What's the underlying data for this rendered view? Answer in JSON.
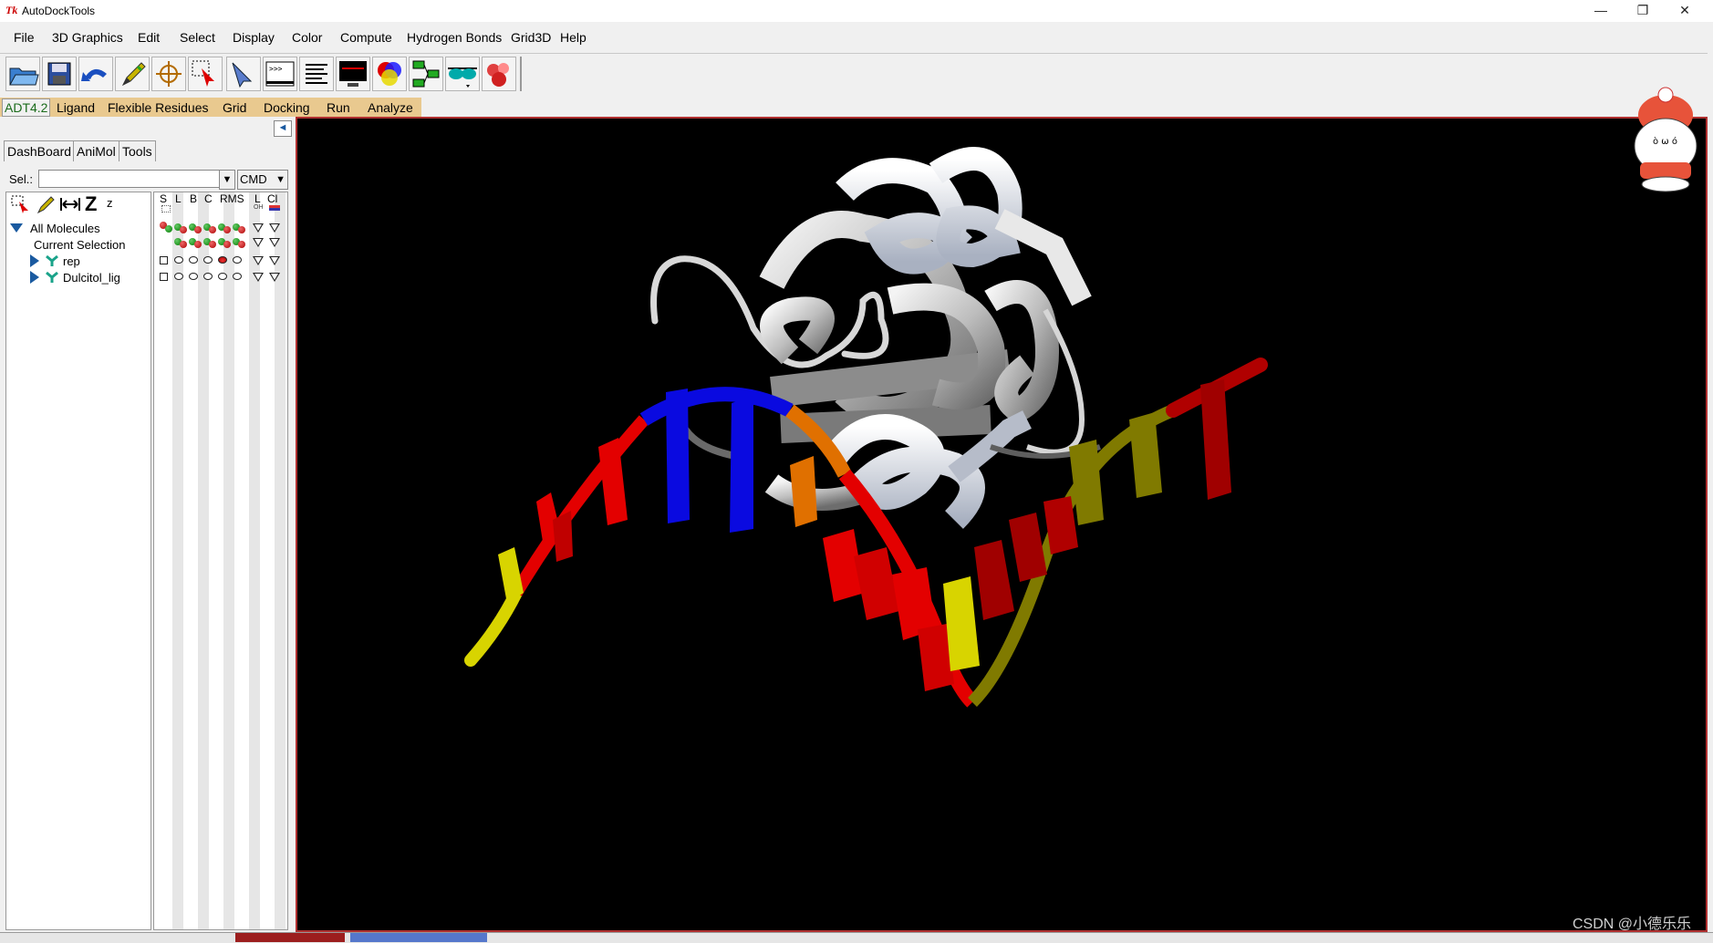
{
  "window": {
    "title": "AutoDockTools",
    "app_icon": "Tk"
  },
  "window_controls": {
    "minimize": "—",
    "restore": "❐",
    "close": "✕"
  },
  "menu": [
    "File",
    "3D Graphics",
    "Edit",
    "Select",
    "Display",
    "Color",
    "Compute",
    "Hydrogen Bonds",
    "Grid3D",
    "Help"
  ],
  "toolbar_icons": [
    "open-file-icon",
    "save-icon",
    "undo-icon",
    "pencil-icon",
    "crosshair-icon",
    "select-icon",
    "pointer-icon",
    "python-shell-icon",
    "text-lines-icon",
    "monitor-icon",
    "sphere-icon",
    "network-icon",
    "stereo-glasses-icon",
    "molecule-icon"
  ],
  "adt_tabs": [
    "ADT4.2",
    "Ligand",
    "Flexible Residues",
    "Grid",
    "Docking",
    "Run",
    "Analyze"
  ],
  "dashboard": {
    "tabs": [
      "DashBoard",
      "AniMol",
      "Tools"
    ],
    "sel_label": "Sel.:",
    "sel_value": "",
    "cmd_label": "CMD",
    "tool_z_big": "Z",
    "tool_z_small": "z",
    "columns": [
      "S",
      "L",
      "B",
      "C",
      "RMS",
      "L",
      "Cl"
    ],
    "column_subs": [
      "",
      "",
      "",
      "",
      "",
      "OH",
      ""
    ],
    "tree": [
      {
        "label": "All Molecules",
        "level": 0,
        "expander": "open"
      },
      {
        "label": "Current Selection",
        "level": 1,
        "expander": "none"
      },
      {
        "label": "rep",
        "level": 2,
        "expander": "closed"
      },
      {
        "label": "Dulcitol_lig",
        "level": 2,
        "expander": "closed"
      }
    ]
  },
  "viewer": {
    "background": "#000000",
    "border_color": "#b03030"
  },
  "colors": {
    "rna_red": "#e30000",
    "rna_blue": "#0a0ae0",
    "rna_yellow": "#d8d400",
    "rna_orange": "#e07000",
    "rna_olive": "#807a00",
    "protein_gray": "#c8c8c8"
  },
  "watermark": "CSDN @小德乐乐"
}
